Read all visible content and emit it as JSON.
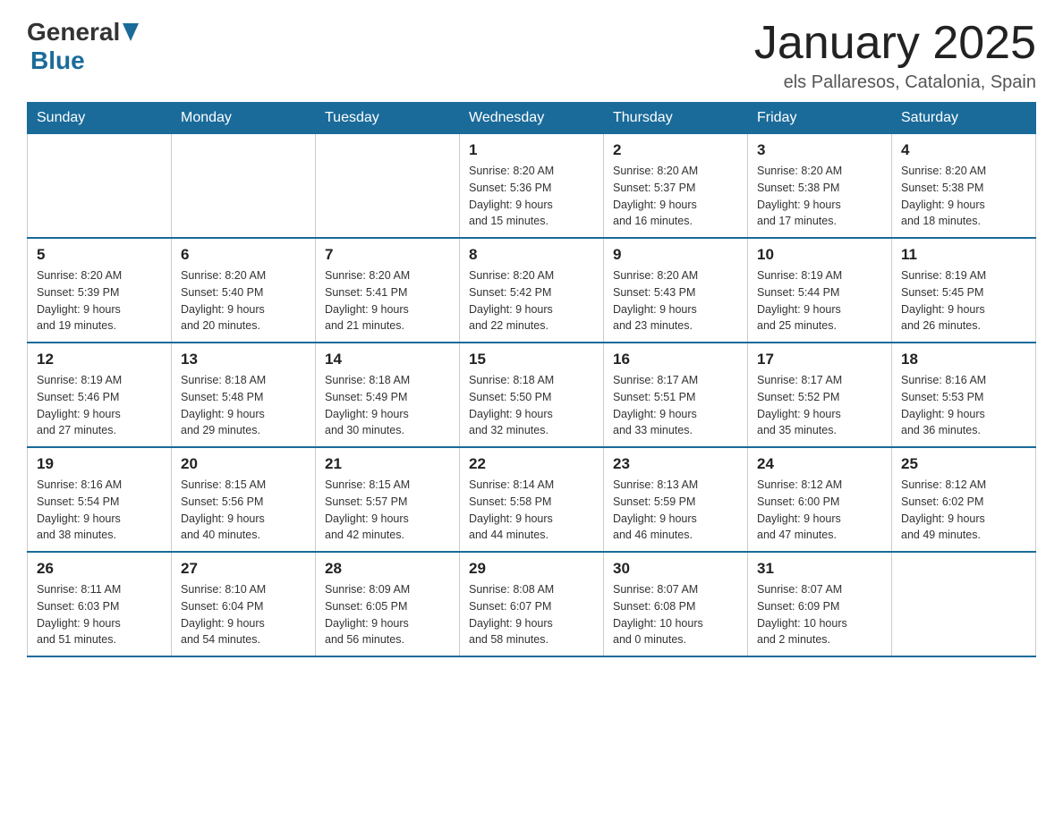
{
  "header": {
    "logo_general": "General",
    "logo_blue": "Blue",
    "title": "January 2025",
    "subtitle": "els Pallaresos, Catalonia, Spain"
  },
  "calendar": {
    "headers": [
      "Sunday",
      "Monday",
      "Tuesday",
      "Wednesday",
      "Thursday",
      "Friday",
      "Saturday"
    ],
    "weeks": [
      [
        {
          "day": "",
          "info": ""
        },
        {
          "day": "",
          "info": ""
        },
        {
          "day": "",
          "info": ""
        },
        {
          "day": "1",
          "info": "Sunrise: 8:20 AM\nSunset: 5:36 PM\nDaylight: 9 hours\nand 15 minutes."
        },
        {
          "day": "2",
          "info": "Sunrise: 8:20 AM\nSunset: 5:37 PM\nDaylight: 9 hours\nand 16 minutes."
        },
        {
          "day": "3",
          "info": "Sunrise: 8:20 AM\nSunset: 5:38 PM\nDaylight: 9 hours\nand 17 minutes."
        },
        {
          "day": "4",
          "info": "Sunrise: 8:20 AM\nSunset: 5:38 PM\nDaylight: 9 hours\nand 18 minutes."
        }
      ],
      [
        {
          "day": "5",
          "info": "Sunrise: 8:20 AM\nSunset: 5:39 PM\nDaylight: 9 hours\nand 19 minutes."
        },
        {
          "day": "6",
          "info": "Sunrise: 8:20 AM\nSunset: 5:40 PM\nDaylight: 9 hours\nand 20 minutes."
        },
        {
          "day": "7",
          "info": "Sunrise: 8:20 AM\nSunset: 5:41 PM\nDaylight: 9 hours\nand 21 minutes."
        },
        {
          "day": "8",
          "info": "Sunrise: 8:20 AM\nSunset: 5:42 PM\nDaylight: 9 hours\nand 22 minutes."
        },
        {
          "day": "9",
          "info": "Sunrise: 8:20 AM\nSunset: 5:43 PM\nDaylight: 9 hours\nand 23 minutes."
        },
        {
          "day": "10",
          "info": "Sunrise: 8:19 AM\nSunset: 5:44 PM\nDaylight: 9 hours\nand 25 minutes."
        },
        {
          "day": "11",
          "info": "Sunrise: 8:19 AM\nSunset: 5:45 PM\nDaylight: 9 hours\nand 26 minutes."
        }
      ],
      [
        {
          "day": "12",
          "info": "Sunrise: 8:19 AM\nSunset: 5:46 PM\nDaylight: 9 hours\nand 27 minutes."
        },
        {
          "day": "13",
          "info": "Sunrise: 8:18 AM\nSunset: 5:48 PM\nDaylight: 9 hours\nand 29 minutes."
        },
        {
          "day": "14",
          "info": "Sunrise: 8:18 AM\nSunset: 5:49 PM\nDaylight: 9 hours\nand 30 minutes."
        },
        {
          "day": "15",
          "info": "Sunrise: 8:18 AM\nSunset: 5:50 PM\nDaylight: 9 hours\nand 32 minutes."
        },
        {
          "day": "16",
          "info": "Sunrise: 8:17 AM\nSunset: 5:51 PM\nDaylight: 9 hours\nand 33 minutes."
        },
        {
          "day": "17",
          "info": "Sunrise: 8:17 AM\nSunset: 5:52 PM\nDaylight: 9 hours\nand 35 minutes."
        },
        {
          "day": "18",
          "info": "Sunrise: 8:16 AM\nSunset: 5:53 PM\nDaylight: 9 hours\nand 36 minutes."
        }
      ],
      [
        {
          "day": "19",
          "info": "Sunrise: 8:16 AM\nSunset: 5:54 PM\nDaylight: 9 hours\nand 38 minutes."
        },
        {
          "day": "20",
          "info": "Sunrise: 8:15 AM\nSunset: 5:56 PM\nDaylight: 9 hours\nand 40 minutes."
        },
        {
          "day": "21",
          "info": "Sunrise: 8:15 AM\nSunset: 5:57 PM\nDaylight: 9 hours\nand 42 minutes."
        },
        {
          "day": "22",
          "info": "Sunrise: 8:14 AM\nSunset: 5:58 PM\nDaylight: 9 hours\nand 44 minutes."
        },
        {
          "day": "23",
          "info": "Sunrise: 8:13 AM\nSunset: 5:59 PM\nDaylight: 9 hours\nand 46 minutes."
        },
        {
          "day": "24",
          "info": "Sunrise: 8:12 AM\nSunset: 6:00 PM\nDaylight: 9 hours\nand 47 minutes."
        },
        {
          "day": "25",
          "info": "Sunrise: 8:12 AM\nSunset: 6:02 PM\nDaylight: 9 hours\nand 49 minutes."
        }
      ],
      [
        {
          "day": "26",
          "info": "Sunrise: 8:11 AM\nSunset: 6:03 PM\nDaylight: 9 hours\nand 51 minutes."
        },
        {
          "day": "27",
          "info": "Sunrise: 8:10 AM\nSunset: 6:04 PM\nDaylight: 9 hours\nand 54 minutes."
        },
        {
          "day": "28",
          "info": "Sunrise: 8:09 AM\nSunset: 6:05 PM\nDaylight: 9 hours\nand 56 minutes."
        },
        {
          "day": "29",
          "info": "Sunrise: 8:08 AM\nSunset: 6:07 PM\nDaylight: 9 hours\nand 58 minutes."
        },
        {
          "day": "30",
          "info": "Sunrise: 8:07 AM\nSunset: 6:08 PM\nDaylight: 10 hours\nand 0 minutes."
        },
        {
          "day": "31",
          "info": "Sunrise: 8:07 AM\nSunset: 6:09 PM\nDaylight: 10 hours\nand 2 minutes."
        },
        {
          "day": "",
          "info": ""
        }
      ]
    ]
  }
}
